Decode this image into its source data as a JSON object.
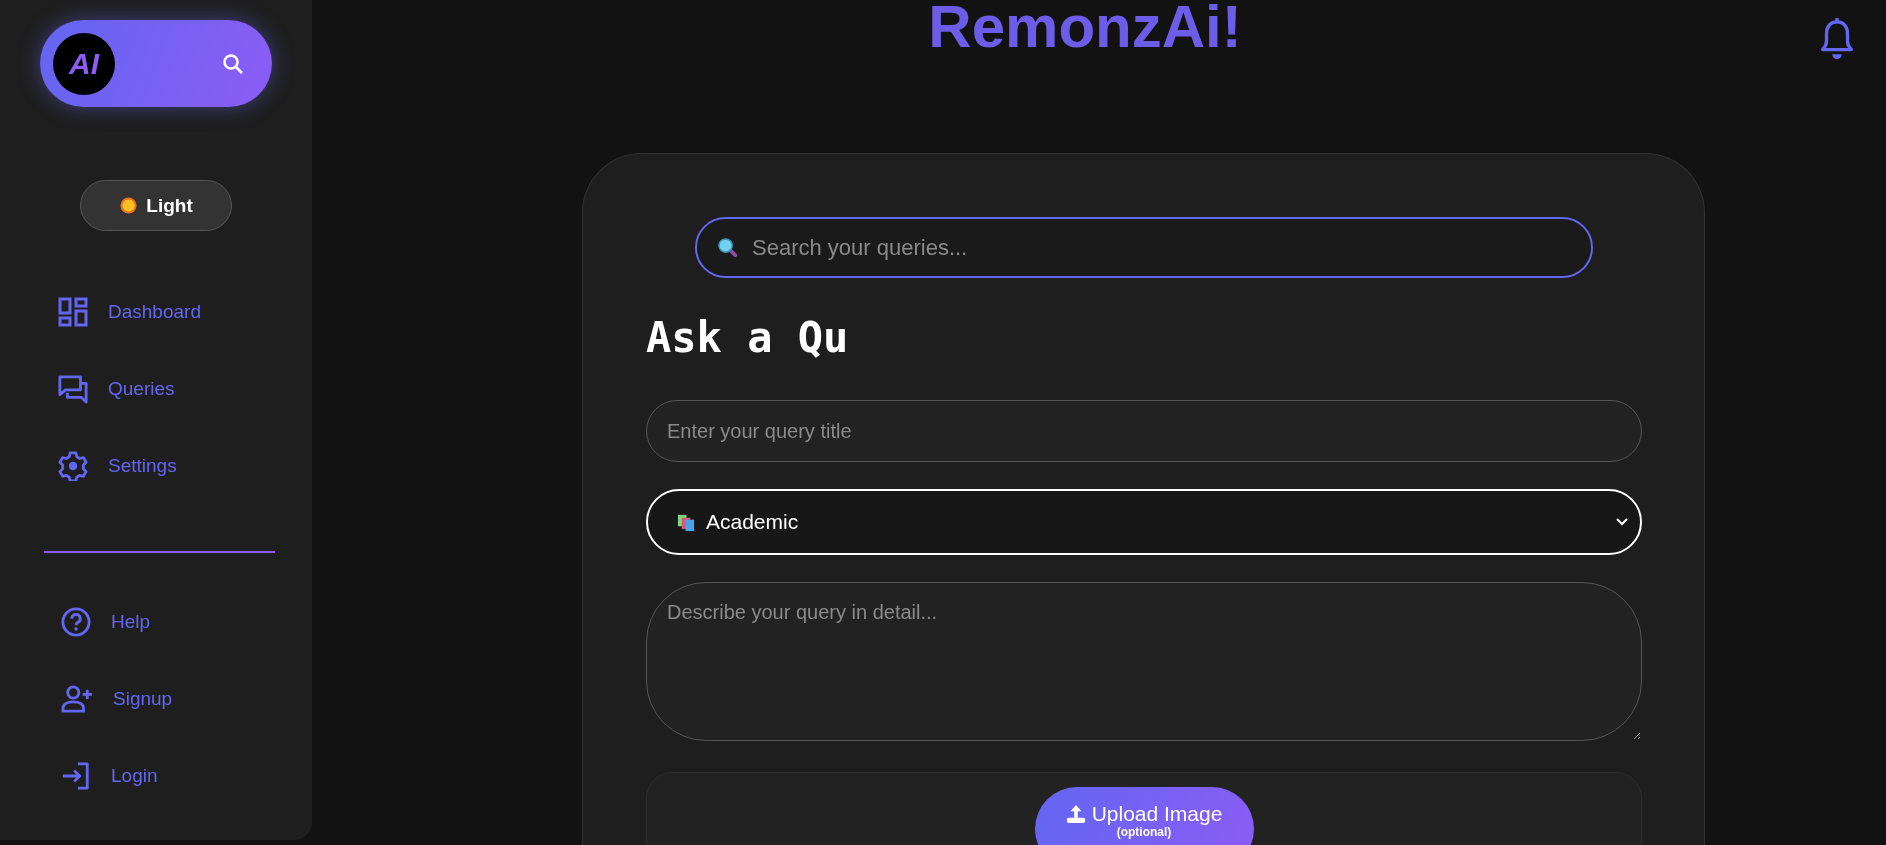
{
  "logo": {
    "badge": "AI"
  },
  "theme_toggle": {
    "label": "Light"
  },
  "nav": [
    {
      "label": "Dashboard",
      "kind": "dashboard"
    },
    {
      "label": "Queries",
      "kind": "chat"
    },
    {
      "label": "Settings",
      "kind": "gear"
    }
  ],
  "nav_secondary": [
    {
      "label": "Help",
      "kind": "help"
    },
    {
      "label": "Signup",
      "kind": "signup"
    },
    {
      "label": "Login",
      "kind": "login"
    }
  ],
  "header": {
    "title": "RemonzAi!"
  },
  "search": {
    "placeholder": "Search your queries..."
  },
  "form": {
    "heading": "Ask a Qu",
    "title_placeholder": "Enter your query title",
    "category": "Academic",
    "description_placeholder": "Describe your query in detail...",
    "upload_label": "Upload Image",
    "upload_note": "(optional)"
  }
}
